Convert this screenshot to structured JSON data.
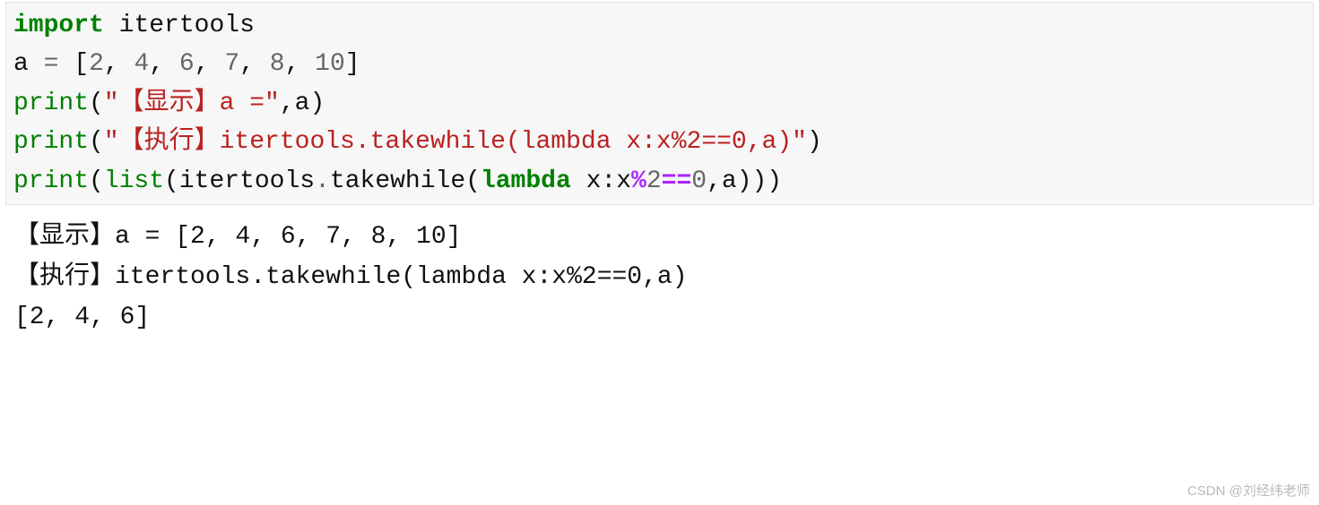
{
  "code": {
    "line1": {
      "import": "import",
      "module": "itertools"
    },
    "line2": {
      "var": "a",
      "eq": "=",
      "lb": "[",
      "v1": "2",
      "c1": ", ",
      "v2": "4",
      "c2": ", ",
      "v3": "6",
      "c3": ", ",
      "v4": "7",
      "c4": ", ",
      "v5": "8",
      "c5": ", ",
      "v6": "10",
      "rb": "]"
    },
    "line3": {
      "print": "print",
      "lp": "(",
      "str": "\"【显示】a =\"",
      "comma": ",",
      "arg": "a",
      "rp": ")"
    },
    "line4": {
      "print": "print",
      "lp": "(",
      "str": "\"【执行】itertools.takewhile(lambda x:x%2==0,a)\"",
      "rp": ")"
    },
    "line5": {
      "print": "print",
      "lp1": "(",
      "list": "list",
      "lp2": "(",
      "obj": "itertools",
      "dot": ".",
      "method": "takewhile",
      "lp3": "(",
      "lambda": "lambda",
      "sp1": " ",
      "x": "x",
      "colon": ":",
      "x2": "x",
      "mod": "%",
      "two": "2",
      "eqeq": "==",
      "zero": "0",
      "comma": ",",
      "a": "a",
      "rp3": ")))"
    }
  },
  "output": {
    "line1": "【显示】a = [2, 4, 6, 7, 8, 10]",
    "line2": "【执行】itertools.takewhile(lambda x:x%2==0,a)",
    "line3": "[2, 4, 6]"
  },
  "watermark": "CSDN @刘经纬老师"
}
